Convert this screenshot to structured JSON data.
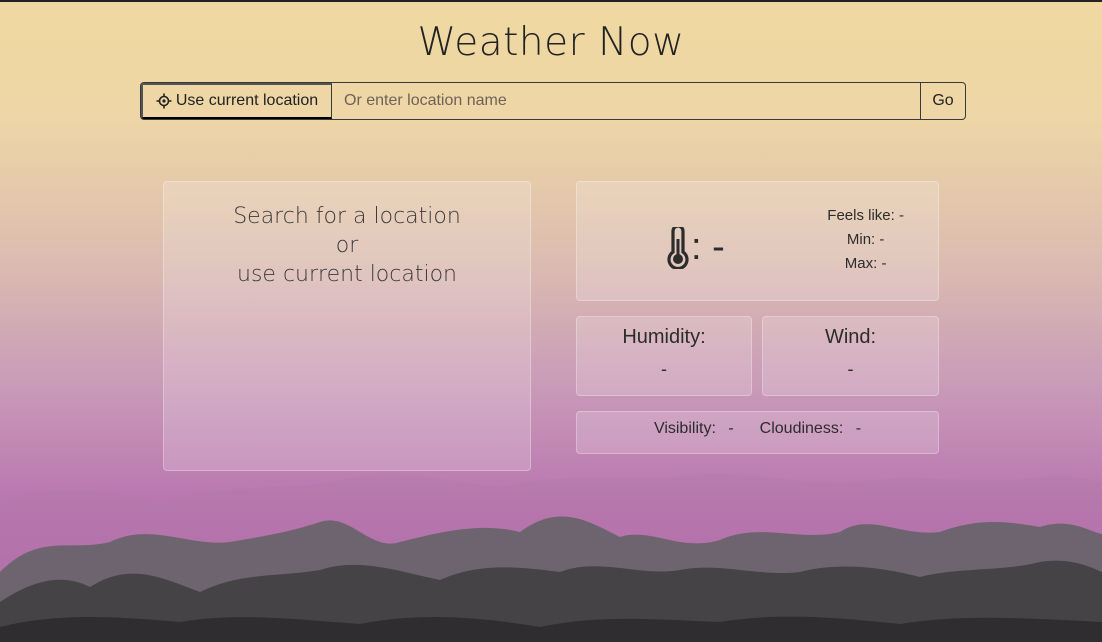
{
  "app": {
    "title": "Weather Now"
  },
  "search": {
    "current_location_label": "Use current location",
    "placeholder": "Or enter location name",
    "value": "",
    "go_label": "Go"
  },
  "location_panel": {
    "line1": "Search for a location",
    "line2": "or",
    "line3": "use current location"
  },
  "temperature": {
    "value": ": -",
    "feels_like_label": "Feels like:",
    "feels_like_value": "-",
    "min_label": "Min:",
    "min_value": "-",
    "max_label": "Max:",
    "max_value": "-"
  },
  "humidity": {
    "label": "Humidity:",
    "value": "-"
  },
  "wind": {
    "label": "Wind:",
    "value": "-"
  },
  "visibility": {
    "label": "Visibility:",
    "value": "-"
  },
  "cloudiness": {
    "label": "Cloudiness:",
    "value": "-"
  },
  "icons": {
    "location": "crosshair-icon",
    "temperature": "thermometer-icon"
  },
  "colors": {
    "sky_top": "#f0d8a2",
    "sky_bottom": "#a85ca6",
    "mountain_far": "#b078a8",
    "mountain_mid": "#6e6470",
    "mountain_near": "#444444"
  }
}
